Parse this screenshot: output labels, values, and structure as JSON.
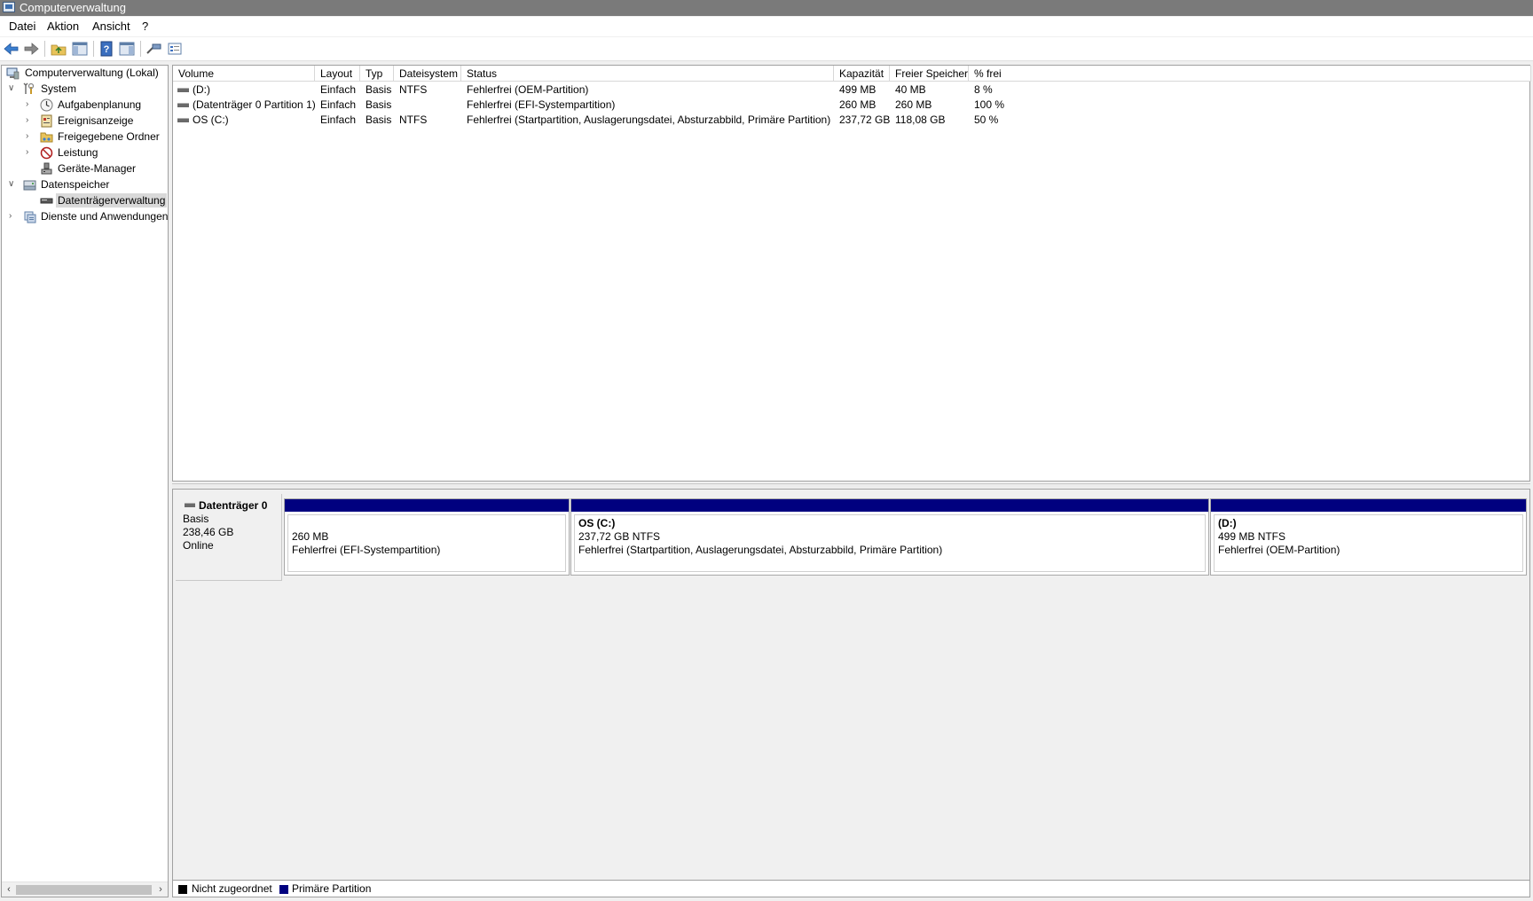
{
  "window": {
    "title": "Computerverwaltung"
  },
  "menu": {
    "items": [
      "Datei",
      "Aktion",
      "Ansicht",
      "?"
    ]
  },
  "toolbar": {
    "buttons": [
      "back-arrow-icon",
      "forward-arrow-icon",
      "up-folder-icon",
      "show-hide-console-tree-icon",
      "help-icon",
      "show-hide-action-pane-icon",
      "connect-icon",
      "properties-icon"
    ]
  },
  "tree": {
    "root": "Computerverwaltung (Lokal)",
    "system": "System",
    "aufgabenplanung": "Aufgabenplanung",
    "ereignisanzeige": "Ereignisanzeige",
    "freigegebene_ordner": "Freigegebene Ordner",
    "leistung": "Leistung",
    "geraete_manager": "Geräte-Manager",
    "datenspeicher": "Datenspeicher",
    "datentraegerverwaltung": "Datenträgerverwaltung",
    "dienste": "Dienste und Anwendungen"
  },
  "volumes": {
    "columns": [
      "Volume",
      "Layout",
      "Typ",
      "Dateisystem",
      "Status",
      "Kapazität",
      "Freier Speicher",
      "% frei"
    ],
    "rows": [
      [
        "(D:)",
        "Einfach",
        "Basis",
        "NTFS",
        "Fehlerfrei (OEM-Partition)",
        "499 MB",
        "40 MB",
        "8 %"
      ],
      [
        "(Datenträger 0 Partition 1)",
        "Einfach",
        "Basis",
        "",
        "Fehlerfrei (EFI-Systempartition)",
        "260 MB",
        "260 MB",
        "100 %"
      ],
      [
        "OS (C:)",
        "Einfach",
        "Basis",
        "NTFS",
        "Fehlerfrei (Startpartition, Auslagerungsdatei, Absturzabbild, Primäre Partition)",
        "237,72 GB",
        "118,08 GB",
        "50 %"
      ]
    ]
  },
  "disk": {
    "name": "Datenträger 0",
    "type": "Basis",
    "size": "238,46 GB",
    "state": "Online",
    "partitions": [
      {
        "name": "",
        "size": "260 MB",
        "status": "Fehlerfrei (EFI-Systempartition)"
      },
      {
        "name": "OS  (C:)",
        "size": "237,72 GB NTFS",
        "status": "Fehlerfrei (Startpartition, Auslagerungsdatei, Absturzabbild, Primäre Partition)"
      },
      {
        "name": " (D:)",
        "size": "499 MB NTFS",
        "status": "Fehlerfrei (OEM-Partition)"
      }
    ]
  },
  "legend": {
    "unallocated": "Nicht zugeordnet",
    "primary": "Primäre Partition",
    "unallocated_color": "#000000",
    "primary_color": "#00007f"
  }
}
